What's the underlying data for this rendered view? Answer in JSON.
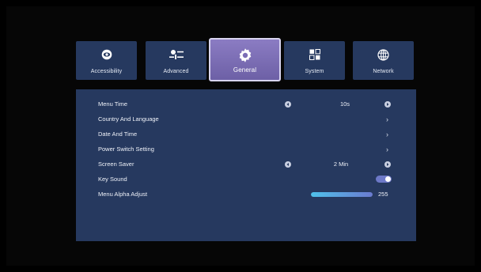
{
  "tabs": [
    {
      "label": "Accessibility",
      "icon": "eye-icon",
      "active": false
    },
    {
      "label": "Advanced",
      "icon": "sliders-icon",
      "active": false
    },
    {
      "label": "General",
      "icon": "gear-icon",
      "active": true
    },
    {
      "label": "System",
      "icon": "grid-icon",
      "active": false
    },
    {
      "label": "Network",
      "icon": "globe-icon",
      "active": false
    }
  ],
  "settings": {
    "menu_time": {
      "label": "Menu Time",
      "value": "10s"
    },
    "country_language": {
      "label": "Country And Language"
    },
    "date_time": {
      "label": "Date And Time"
    },
    "power_switch": {
      "label": "Power Switch Setting"
    },
    "screen_saver": {
      "label": "Screen Saver",
      "value": "2 Min"
    },
    "key_sound": {
      "label": "Key Sound",
      "enabled": true
    },
    "menu_alpha": {
      "label": "Menu Alpha Adjust",
      "value": "255",
      "fraction": 1.0
    }
  },
  "glyphs": {
    "chevron": "›"
  },
  "colors": {
    "tab_bg": "#26395f",
    "active_tab": "#7b6db5",
    "panel_bg": "#26395f",
    "toggle_on": "#6d79c8",
    "slider_start": "#4fc1ea",
    "slider_end": "#6b7bd0"
  }
}
